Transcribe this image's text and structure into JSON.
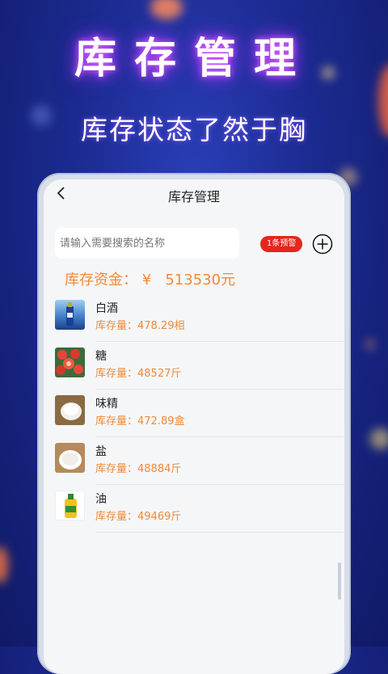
{
  "hero": {
    "title": "库存管理",
    "subtitle": "库存状态了然于胸"
  },
  "nav": {
    "back_icon": "chevron-left-icon",
    "title": "库存管理"
  },
  "search": {
    "placeholder": "请输入需要搜索的名称",
    "value": ""
  },
  "warning": {
    "label": "1条预警"
  },
  "add": {
    "icon": "plus-circle-icon"
  },
  "funds": {
    "label": "库存资金：",
    "currency": "¥",
    "amount": "513530元"
  },
  "items": [
    {
      "name": "白酒",
      "stock": "库存量：478.29相",
      "thumb_icon": "liquor-bottle-image"
    },
    {
      "name": "糖",
      "stock": "库存量：48527斤",
      "thumb_icon": "candy-image"
    },
    {
      "name": "味精",
      "stock": "库存量：472.89盒",
      "thumb_icon": "msg-bowl-image"
    },
    {
      "name": "盐",
      "stock": "库存量：48884斤",
      "thumb_icon": "salt-bowl-image"
    },
    {
      "name": "油",
      "stock": "库存量：49469斤",
      "thumb_icon": "oil-bottle-image"
    }
  ],
  "colors": {
    "accent_orange": "#f08a39",
    "badge_red": "#e5261b",
    "background_blue": "#1b2a8f"
  }
}
